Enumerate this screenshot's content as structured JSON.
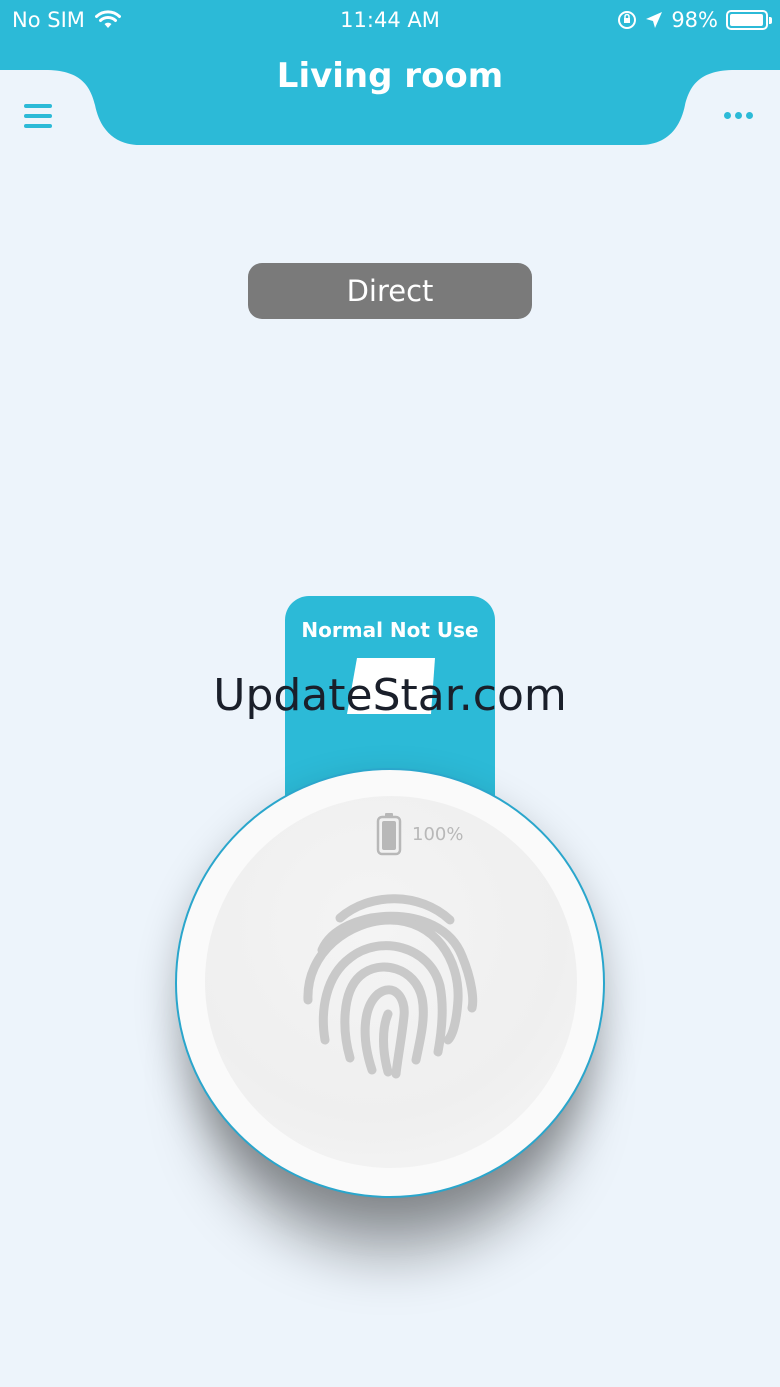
{
  "status_bar": {
    "carrier": "No SIM",
    "time": "11:44 AM",
    "battery_percent": "98%"
  },
  "header": {
    "title": "Living room",
    "accent_color": "#2cbad7"
  },
  "mode_badge": {
    "label": "Direct"
  },
  "device_card": {
    "title": "Normal Not Use"
  },
  "watermark": {
    "text": "UpdateStar.com"
  },
  "device": {
    "battery_percent": "100%",
    "icon": "fingerprint-icon"
  }
}
